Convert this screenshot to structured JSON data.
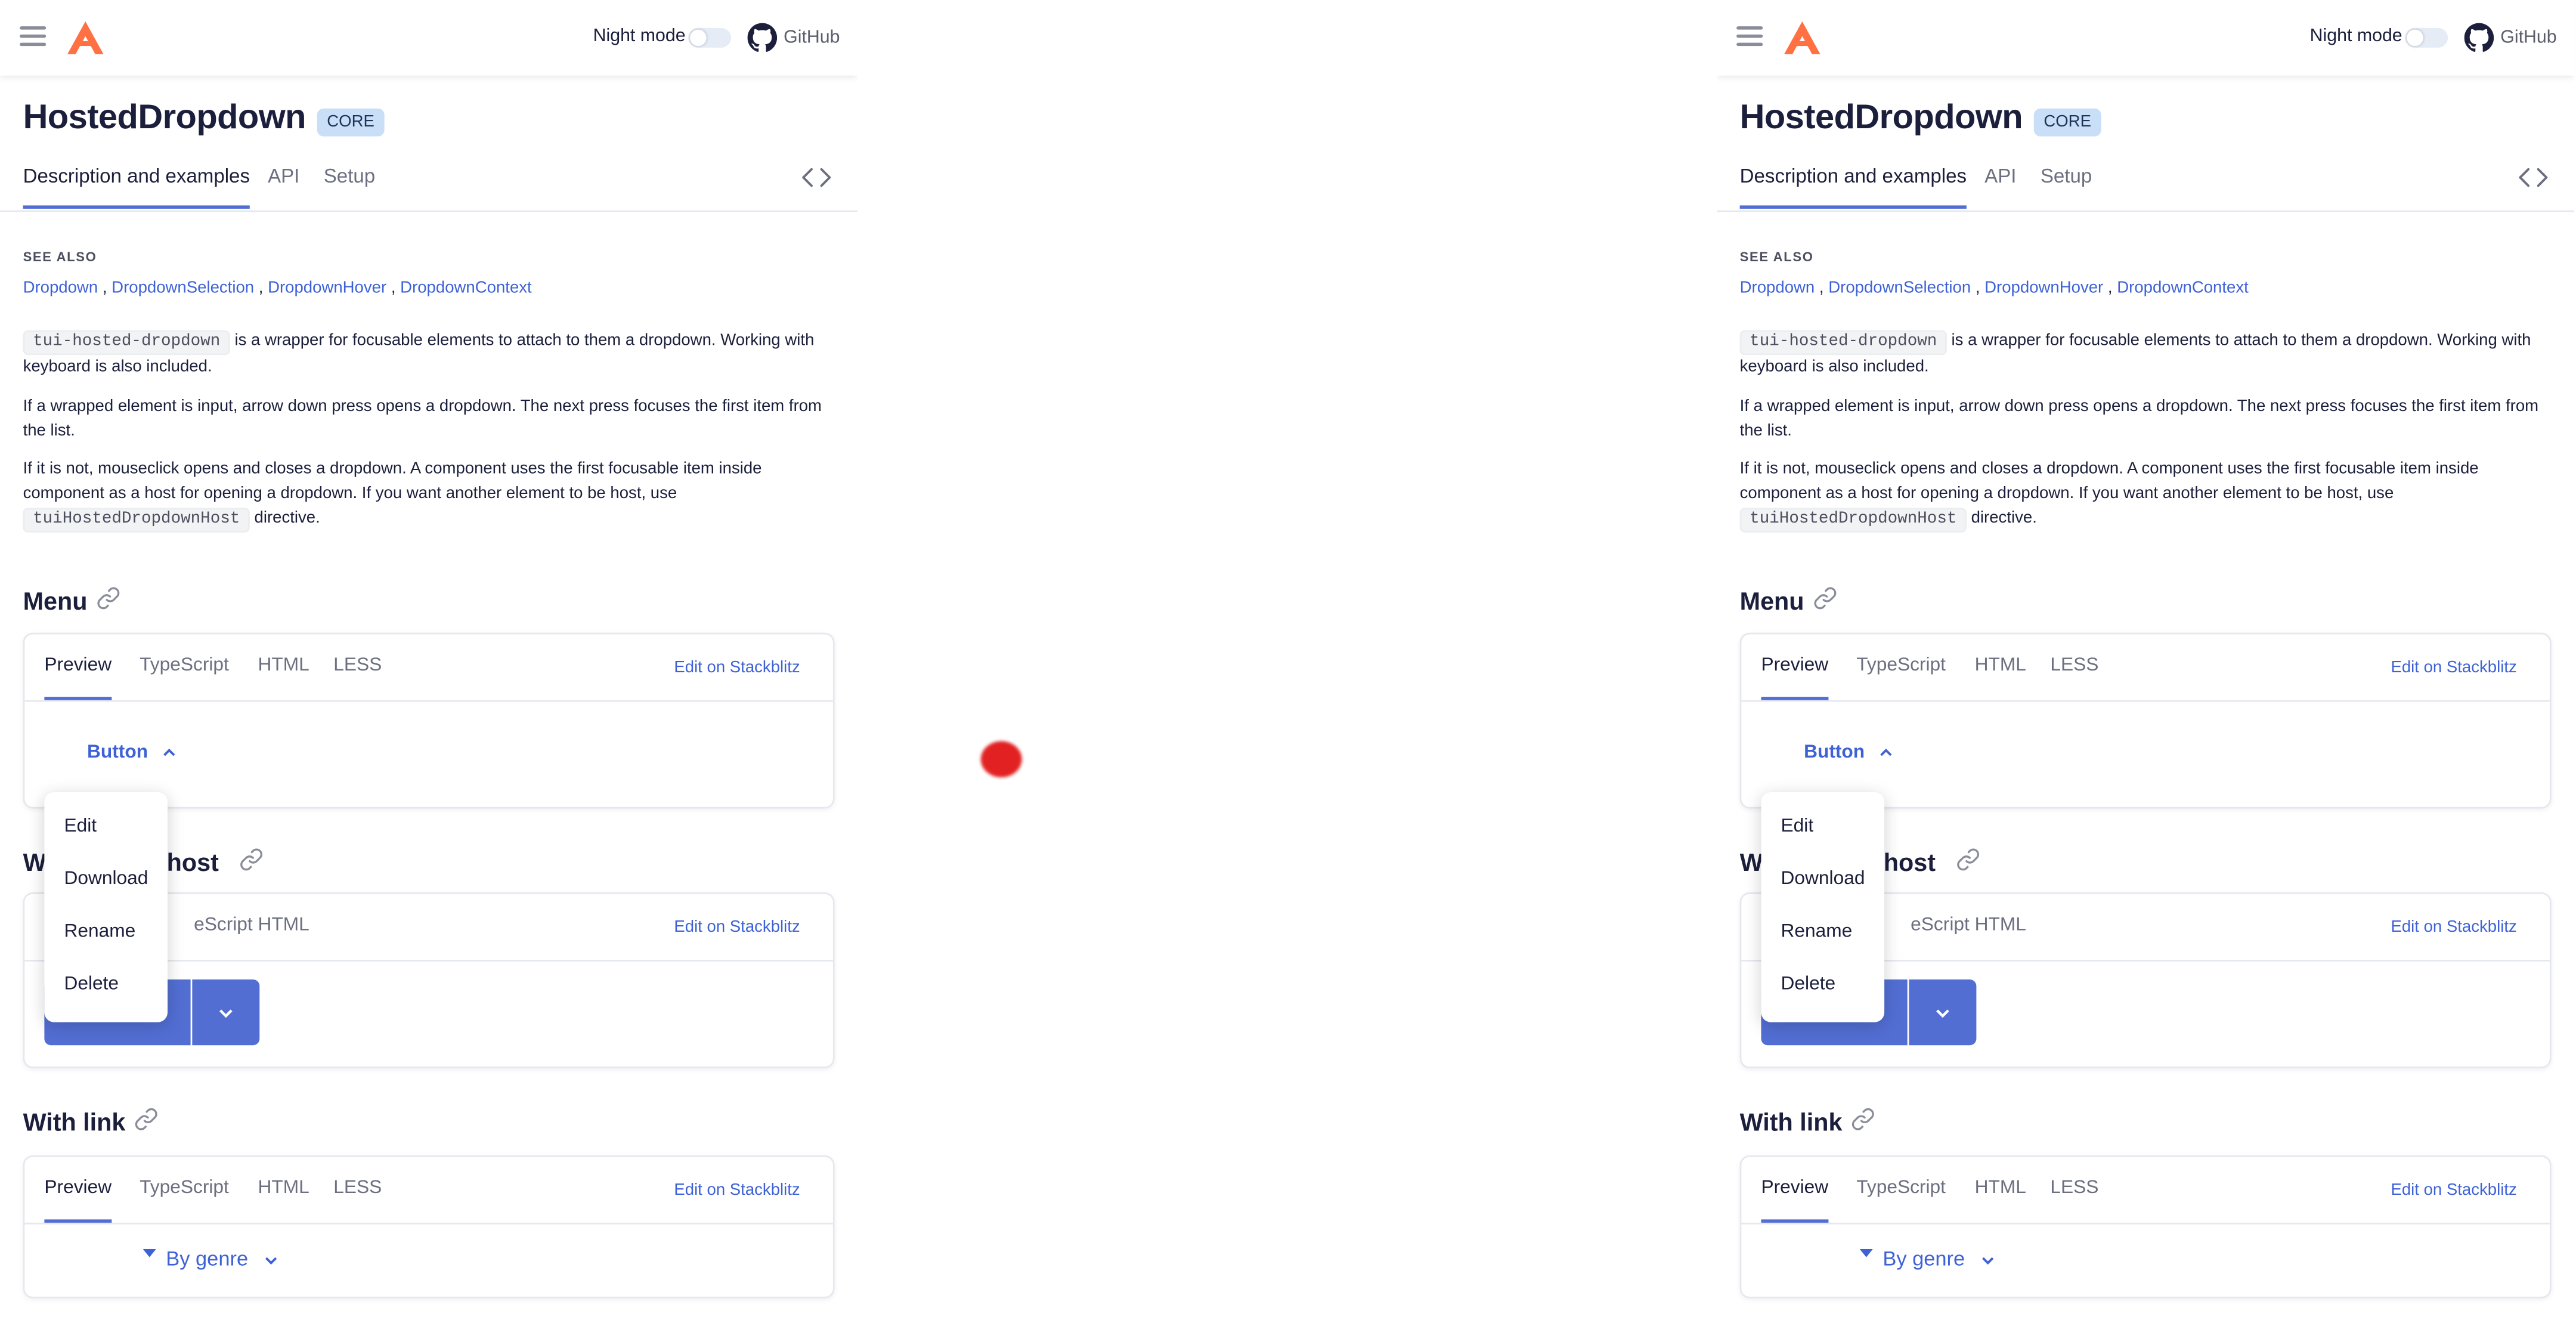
{
  "header": {
    "night_mode_label": "Night mode",
    "github_label": "GitHub",
    "icons": {
      "menu": "hamburger-icon",
      "logo": "taiga-logo",
      "github": "github-icon"
    }
  },
  "page": {
    "title": "HostedDropdown",
    "badge": "CORE",
    "tabs": [
      "Description and examples",
      "API",
      "Setup"
    ]
  },
  "see_also": {
    "heading": "SEE ALSO",
    "links": [
      "Dropdown",
      "DropdownSelection",
      "DropdownHover",
      "DropdownContext"
    ],
    "separator": ","
  },
  "description": {
    "p1_code": "tui-hosted-dropdown",
    "p1_text": "is a wrapper for focusable elements to attach to them a dropdown. Working with keyboard is also included.",
    "p2_text": "If a wrapped element is input, arrow down press opens a dropdown. The next press focuses the first item from the list.",
    "p3_text": "If it is not, mouseclick opens and closes a dropdown. A component uses the first focusable item inside component as a host for opening a dropdown. If you want another element to be host, use",
    "p3_code": "tuiHostedDropdownHost",
    "p3_end": "directive."
  },
  "sections": {
    "menu": {
      "title": "Menu",
      "tabs": [
        "Preview",
        "TypeScript",
        "HTML",
        "LESS"
      ],
      "stackblitz": "Edit on Stackblitz",
      "button_label": "Button"
    },
    "host": {
      "title_visible_start": "W",
      "title_visible_end": "n host",
      "tabs_visible": [
        "eScript",
        "HTML"
      ],
      "stackblitz": "Edit on Stackblitz"
    },
    "link": {
      "title": "With link",
      "tabs": [
        "Preview",
        "TypeScript",
        "HTML",
        "LESS"
      ],
      "stackblitz": "Edit on Stackblitz",
      "genre_label": "By genre"
    }
  },
  "dropdown": {
    "items": [
      "Edit",
      "Download",
      "Rename",
      "Delete"
    ]
  },
  "colors": {
    "accent": "#526ed3",
    "link": "#3e62d6",
    "text": "#1b1f3b",
    "badge_bg": "#c9def7",
    "logo": "#ff7043",
    "cursor_dot": "#e22222"
  }
}
